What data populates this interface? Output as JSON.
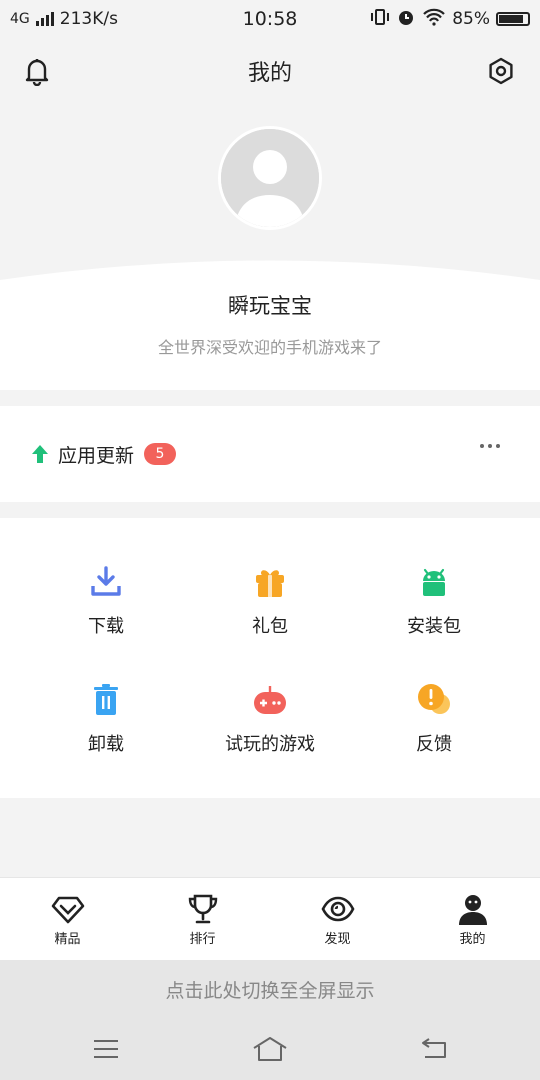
{
  "status_bar": {
    "network": "4G",
    "speed": "213K/s",
    "time": "10:58",
    "battery": "85%"
  },
  "header": {
    "title": "我的",
    "left_icon": "bell-icon",
    "right_icon": "settings-icon"
  },
  "profile": {
    "name": "瞬玩宝宝",
    "tagline": "全世界深受欢迎的手机游戏来了"
  },
  "updates": {
    "label": "应用更新",
    "badge": "5"
  },
  "tools": [
    {
      "label": "下载",
      "icon": "download-icon",
      "color": "#5b7be8"
    },
    {
      "label": "礼包",
      "icon": "gift-icon",
      "color": "#f7a625"
    },
    {
      "label": "安装包",
      "icon": "android-icon",
      "color": "#20c07a"
    },
    {
      "label": "卸载",
      "icon": "trash-icon",
      "color": "#3aa4f2"
    },
    {
      "label": "试玩的游戏",
      "icon": "gamepad-icon",
      "color": "#f2625b"
    },
    {
      "label": "反馈",
      "icon": "feedback-icon",
      "color": "#f7a625"
    }
  ],
  "bottom_nav": [
    {
      "label": "精品",
      "icon": "diamond-icon"
    },
    {
      "label": "排行",
      "icon": "trophy-icon"
    },
    {
      "label": "发现",
      "icon": "eye-icon"
    },
    {
      "label": "我的",
      "icon": "user-icon",
      "active": true
    }
  ],
  "fullscreen_hint": "点击此处切换至全屏显示",
  "colors": {
    "accent_green": "#20c07a",
    "badge_red": "#f2625b"
  }
}
